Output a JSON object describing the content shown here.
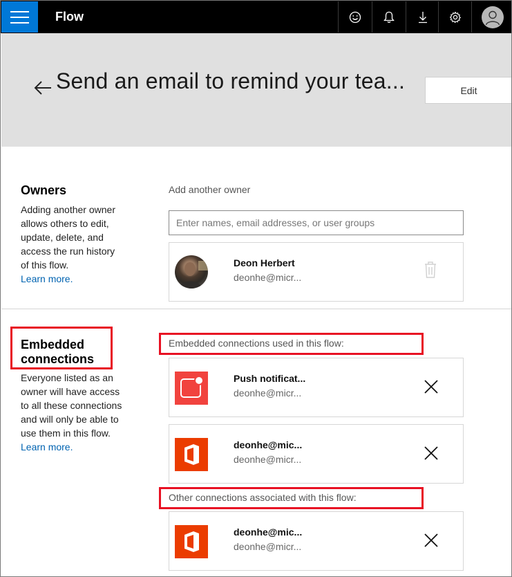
{
  "app": {
    "title": "Flow"
  },
  "topbar": {
    "icons": [
      "menu-icon",
      "smiley-icon",
      "bell-icon",
      "download-icon",
      "gear-icon",
      "user-avatar-icon"
    ]
  },
  "header": {
    "title": "Send an email to remind your tea...",
    "edit_label": "Edit"
  },
  "owners": {
    "title": "Owners",
    "description": "Adding another owner allows others to edit, update, delete, and access the run history of this flow.",
    "learn_more": "Learn more.",
    "add_label": "Add another owner",
    "input_placeholder": "Enter names, email addresses, or user groups",
    "list": [
      {
        "name": "Deon Herbert",
        "email": "deonhe@micr..."
      }
    ]
  },
  "embedded": {
    "title": "Embedded connections",
    "description": "Everyone listed as an owner will have access to all these connections and will only be able to use them in this flow.",
    "learn_more": "Learn more.",
    "used_label": "Embedded connections used in this flow:",
    "other_label": "Other connections associated with this flow:",
    "used": [
      {
        "name": "Push notificat...",
        "email": "deonhe@micr...",
        "icon": "push-notification-icon",
        "color": "#f1433e"
      },
      {
        "name": "deonhe@mic...",
        "email": "deonhe@micr...",
        "icon": "office-icon",
        "color": "#eb3c00"
      }
    ],
    "other": [
      {
        "name": "deonhe@mic...",
        "email": "deonhe@micr...",
        "icon": "office-icon",
        "color": "#eb3c00"
      }
    ]
  },
  "colors": {
    "topbar": "#000000",
    "accent": "#0078d7",
    "header_bg": "#e0e0e0",
    "highlight": "#e81123",
    "link": "#0063b1"
  }
}
